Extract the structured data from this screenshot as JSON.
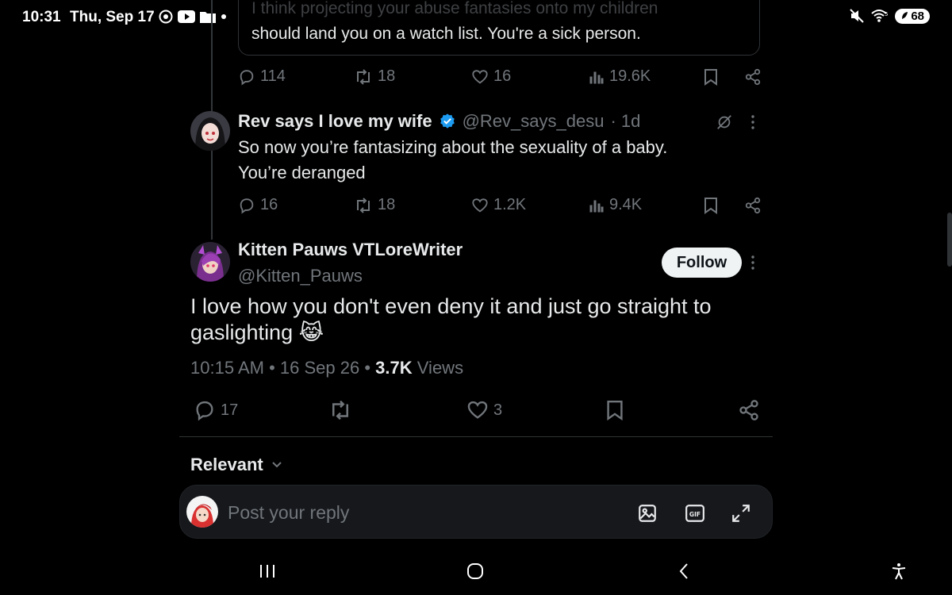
{
  "status_bar": {
    "time": "10:31",
    "date": "Thu, Sep 17",
    "battery": "68",
    "wifi_label": "5"
  },
  "quoted_tweet": {
    "faded_line": "I think projecting your abuse fantasies onto my children",
    "text": "should land you on a watch list. You're a sick person.",
    "replies": "114",
    "reposts": "18",
    "likes": "16",
    "views": "19.6K"
  },
  "reply_tweet": {
    "name": "Rev says I love my wife",
    "handle": "@Rev_says_desu",
    "time": "· 1d",
    "text_line1": "So now you’re fantasizing about the sexuality of a baby.",
    "text_line2": "You’re deranged",
    "replies": "16",
    "reposts": "18",
    "likes": "1.2K",
    "views": "9.4K"
  },
  "main_tweet": {
    "name": "Kitten Pauws VTLoreWriter",
    "handle": "@Kitten_Pauws",
    "follow_label": "Follow",
    "text": "I love how you don't even deny it and just go straight to gaslighting 😹",
    "time": "10:15 AM",
    "date": "16 Sep 26",
    "views_count": "3.7K",
    "views_label": "Views",
    "replies": "17",
    "likes": "3"
  },
  "sort": {
    "label": "Relevant"
  },
  "reply_bar": {
    "placeholder": "Post your reply"
  },
  "colors": {
    "background": "#000000",
    "text_primary": "#e7e9ea",
    "text_secondary": "#71767b",
    "verified": "#1d9bf0",
    "border": "#2f3336"
  }
}
